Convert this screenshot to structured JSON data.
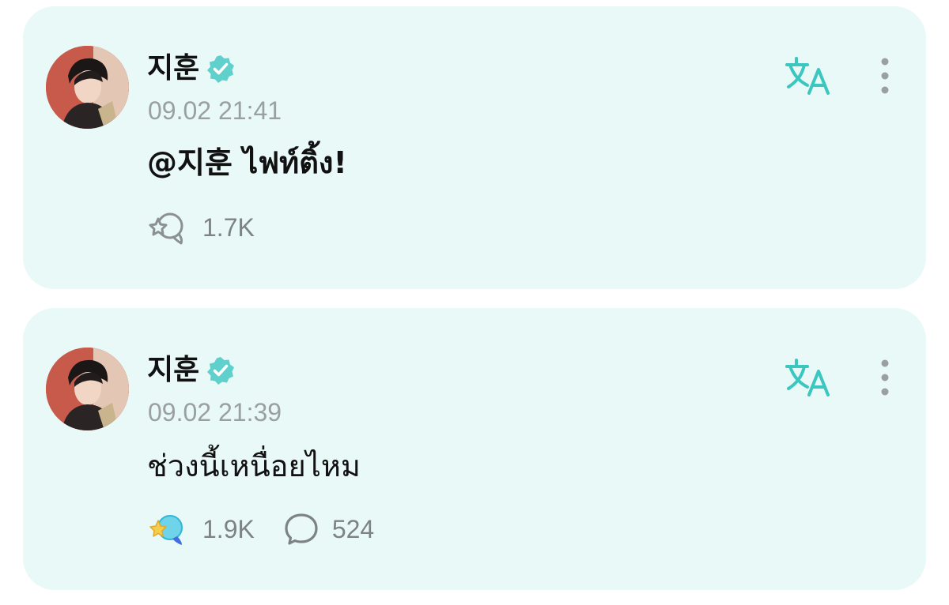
{
  "colors": {
    "card_background": "#e9f9f7",
    "accent": "#3cc6c0",
    "text_primary": "#111111",
    "text_secondary": "#9aa09f"
  },
  "posts": [
    {
      "author": "지훈",
      "verified": true,
      "timestamp": "09.02 21:41",
      "text": "@지훈 ไฟท์ติ้ง!",
      "reaction_icon": "sparkle-bubble-outline-icon",
      "reaction_count": "1.7K",
      "comment_count": null
    },
    {
      "author": "지훈",
      "verified": true,
      "timestamp": "09.02 21:39",
      "text": "ช่วงนี้เหนื่อยไหม",
      "reaction_icon": "sparkle-bubble-filled-icon",
      "reaction_count": "1.9K",
      "comment_icon": "comment-bubble-icon",
      "comment_count": "524"
    }
  ]
}
